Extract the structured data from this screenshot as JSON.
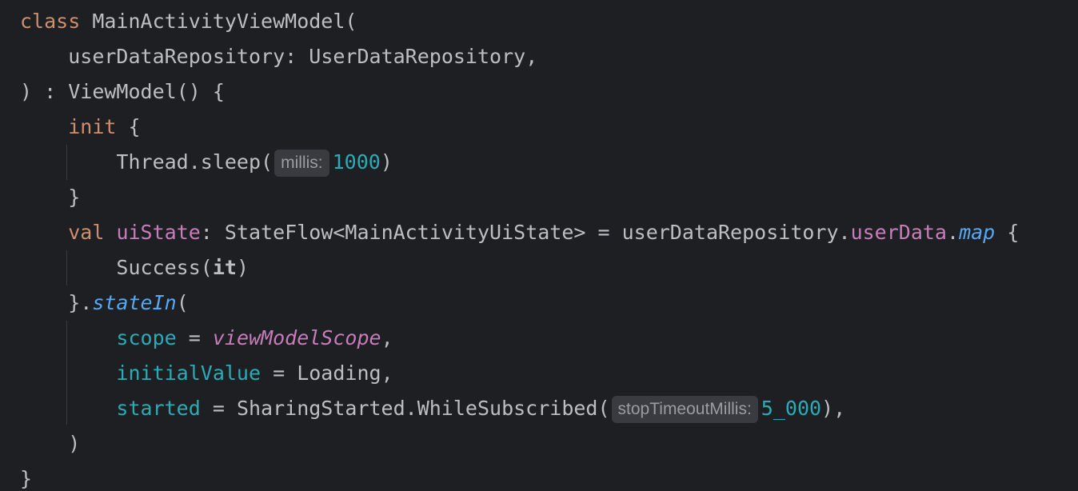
{
  "editor": {
    "background": "#1e1f22",
    "lines": [
      {
        "kw": "class",
        "name": "MainActivityViewModel",
        "punct": "("
      },
      {
        "param": "userDataRepository",
        "sep": ": ",
        "type": "UserDataRepository",
        "punct": ","
      },
      {
        "open": ")",
        "sep": " : ",
        "type": "ViewModel",
        "punct": "() {"
      },
      {
        "kw": "init",
        "punct": " {"
      },
      {
        "call": "Thread.sleep(",
        "hint": "millis:",
        "num": "1000",
        "close": ")"
      },
      {
        "punct": "}"
      },
      {
        "kw": "val",
        "prop": "uiState",
        "sep": ": ",
        "type": "StateFlow<MainActivityUiState> = userDataRepository.",
        "prop2": "userData",
        "dot": ".",
        "ext": "map",
        "punct": " {"
      },
      {
        "call": "Success(",
        "it": "it",
        "close": ")"
      },
      {
        "punct": "}.",
        "ext": "stateIn",
        "close": "("
      },
      {
        "named": "scope",
        "eq": " = ",
        "glob": "viewModelScope",
        "punct": ","
      },
      {
        "named": "initialValue",
        "eq": " = ",
        "value": "Loading",
        "punct": ","
      },
      {
        "named": "started",
        "eq": " = ",
        "call": "SharingStarted.WhileSubscribed(",
        "hint": "stopTimeoutMillis:",
        "num": "5_000",
        "close": "),"
      },
      {
        "punct": ")"
      },
      {
        "punct": "}"
      }
    ]
  }
}
